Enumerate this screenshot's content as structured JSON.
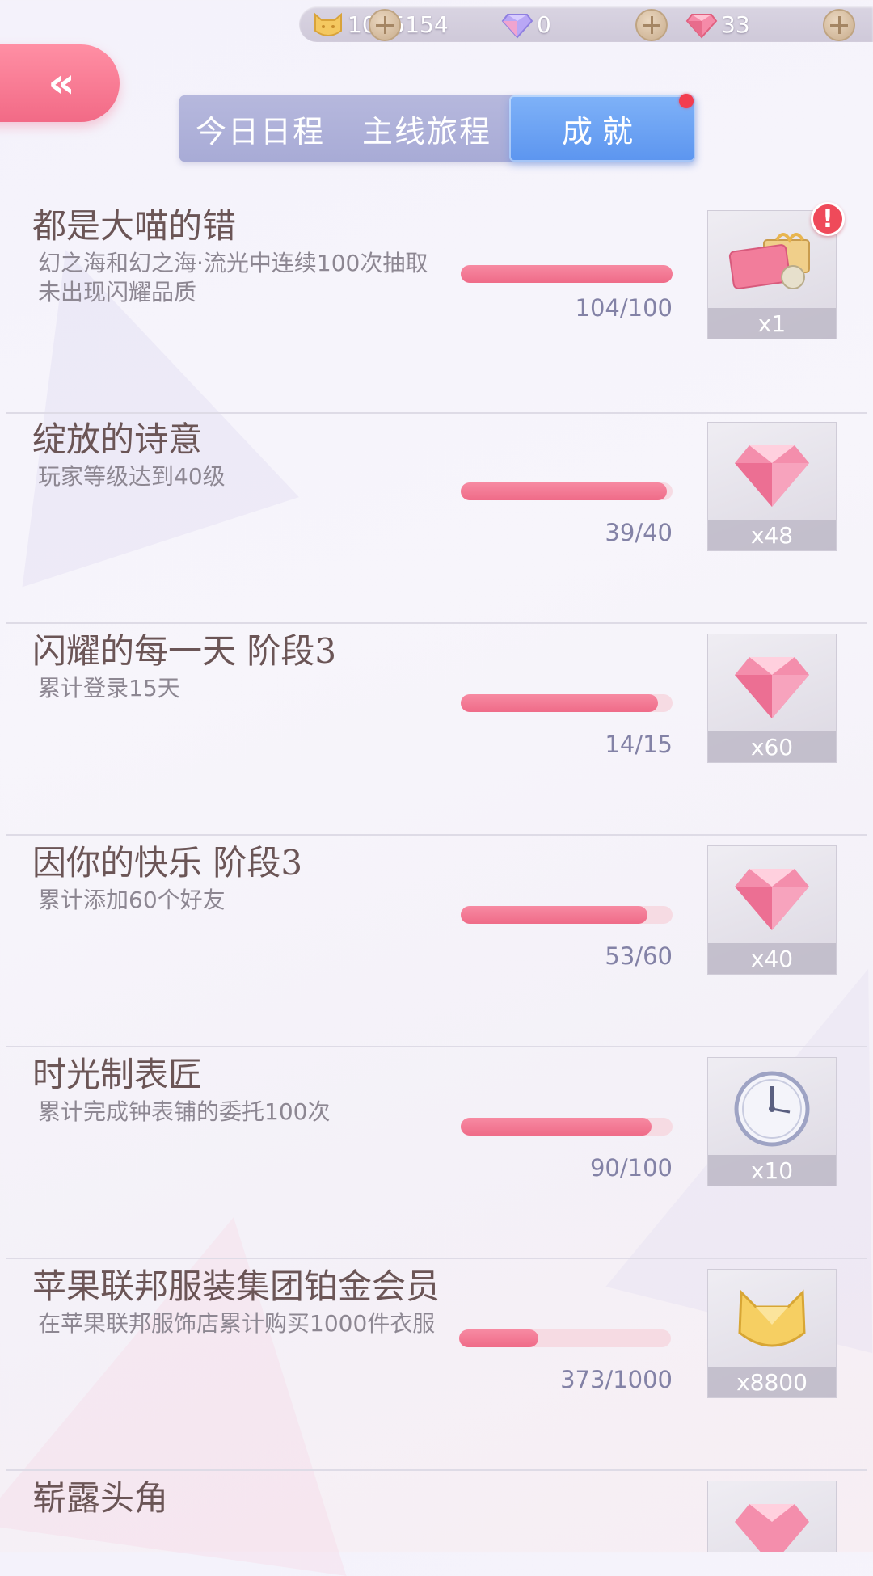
{
  "currency": {
    "coins": "1035154",
    "blue_diamonds": "0",
    "pink_diamonds": "33",
    "coin_icon": "cat-coin-icon",
    "blue_diamond_icon": "blue-diamond-icon",
    "pink_diamond_icon": "pink-diamond-icon"
  },
  "back_button": {
    "icon": "double-chevron-left-icon",
    "label": "«"
  },
  "tabs": [
    {
      "label": "今日日程",
      "active": false
    },
    {
      "label": "主线旅程",
      "active": false
    },
    {
      "label": "成就",
      "active": true
    }
  ],
  "achievements": [
    {
      "title": "都是大喵的错",
      "desc": "幻之海和幻之海·流光中连续100次抽取未出现闪耀品质",
      "progress": "104/100",
      "ratio": 1.0,
      "reward_icon": "gift-box-icon",
      "reward_count": "x1",
      "alert": "!"
    },
    {
      "title": "绽放的诗意",
      "desc": "玩家等级达到40级",
      "progress": "39/40",
      "ratio": 0.975,
      "reward_icon": "pink-diamond-icon",
      "reward_count": "x48"
    },
    {
      "title": "闪耀的每一天 阶段3",
      "desc": "累计登录15天",
      "progress": "14/15",
      "ratio": 0.933,
      "reward_icon": "pink-diamond-icon",
      "reward_count": "x60"
    },
    {
      "title": "因你的快乐 阶段3",
      "desc": "累计添加60个好友",
      "progress": "53/60",
      "ratio": 0.883,
      "reward_icon": "pink-diamond-icon",
      "reward_count": "x40"
    },
    {
      "title": "时光制表匠",
      "desc": "累计完成钟表铺的委托100次",
      "progress": "90/100",
      "ratio": 0.9,
      "reward_icon": "clock-icon",
      "reward_count": "x10"
    },
    {
      "title": "苹果联邦服装集团铂金会员",
      "desc": "在苹果联邦服饰店累计购买1000件衣服",
      "progress": "373/1000",
      "ratio": 0.373,
      "reward_icon": "gold-cat-coin-icon",
      "reward_count": "x8800"
    },
    {
      "title": "崭露头角",
      "desc": "",
      "progress": "",
      "ratio": null,
      "reward_icon": "pink-diamond-icon",
      "reward_count": ""
    }
  ],
  "colors": {
    "accent_pink": "#ef6b88",
    "tab_active": "#5c95ef",
    "tab_bg": "#a8abd6",
    "alert_red": "#ef4a5a"
  }
}
